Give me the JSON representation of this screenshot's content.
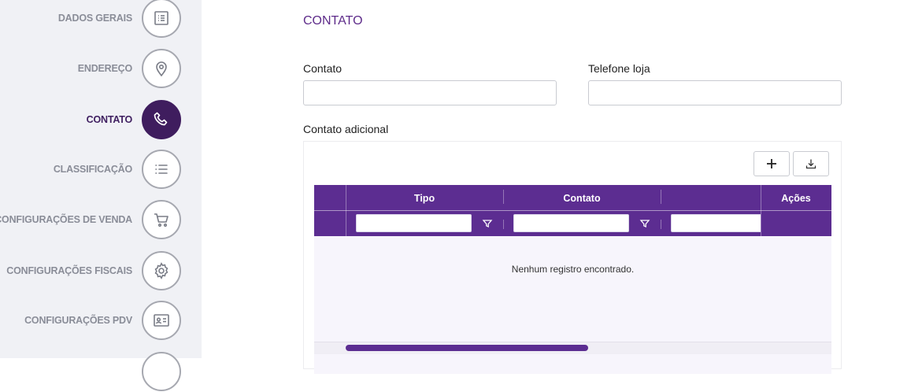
{
  "sidebar": {
    "steps": [
      {
        "label": "DADOS GERAIS",
        "icon": "list-document-icon",
        "active": false
      },
      {
        "label": "ENDEREÇO",
        "icon": "map-pin-icon",
        "active": false
      },
      {
        "label": "CONTATO",
        "icon": "phone-icon",
        "active": true
      },
      {
        "label": "CLASSIFICAÇÃO",
        "icon": "list-icon",
        "active": false
      },
      {
        "label": "CONFIGURAÇÕES DE VENDA",
        "icon": "cart-icon",
        "active": false
      },
      {
        "label": "CONFIGURAÇÕES FISCAIS",
        "icon": "gear-icon",
        "active": false
      },
      {
        "label": "CONFIGURAÇÕES PDV",
        "icon": "id-card-icon",
        "active": false
      }
    ]
  },
  "form": {
    "section_title": "CONTATO",
    "contato_label": "Contato",
    "contato_value": "",
    "telefone_label": "Telefone loja",
    "telefone_value": "",
    "adicional_label": "Contato adicional"
  },
  "grid": {
    "columns": [
      "Tipo",
      "Contato",
      "",
      "Ações"
    ],
    "empty_message": "Nenhum registro encontrado.",
    "filters": [
      "",
      "",
      ""
    ]
  },
  "colors": {
    "accent": "#5c2d91",
    "active_step": "#3f1d5e",
    "title": "#5e2c8a"
  }
}
